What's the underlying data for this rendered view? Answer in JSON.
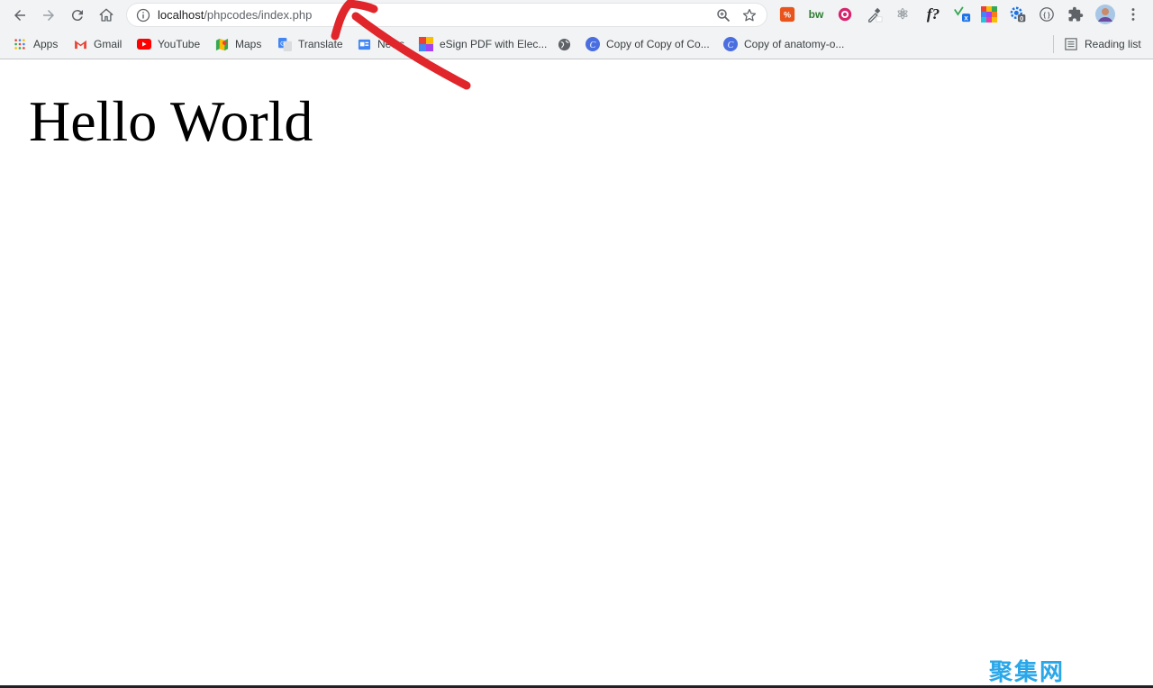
{
  "address_bar": {
    "url_host": "localhost",
    "url_path": "/phpcodes/index.php"
  },
  "extensions": [
    {
      "name": "extension-orange-icon",
      "glyph": "⁷⁄₂",
      "color": "#e8541c"
    },
    {
      "name": "extension-bw-icon",
      "glyph": "bw",
      "color": "#2e7d32"
    },
    {
      "name": "extension-eye-icon",
      "glyph": "◉",
      "color": "#d6246e"
    },
    {
      "name": "eyedropper-icon",
      "glyph": "",
      "color": "#5f6368"
    },
    {
      "name": "extension-react-icon",
      "glyph": "⚛",
      "color": "#9aa0a6"
    },
    {
      "name": "extension-fx-icon",
      "glyph": "f?",
      "color": "#202124"
    },
    {
      "name": "extension-translate-icon",
      "glyph": "x",
      "color": "#1a73e8"
    },
    {
      "name": "extension-grid-icon",
      "glyph": "",
      "color": "#fbbc04"
    },
    {
      "name": "extension-gear-badge-icon",
      "glyph": "0",
      "color": "#1a73e8"
    },
    {
      "name": "extension-braces-icon",
      "glyph": "{ }",
      "color": "#5f6368"
    }
  ],
  "bookmarks": [
    {
      "label": "Apps"
    },
    {
      "label": "Gmail"
    },
    {
      "label": "YouTube"
    },
    {
      "label": "Maps"
    },
    {
      "label": "Translate"
    },
    {
      "label": "News"
    },
    {
      "label": "eSign PDF with Elec..."
    },
    {
      "label": "Copy of Copy of Co..."
    },
    {
      "label": "Copy of anatomy-o..."
    }
  ],
  "reading_list": {
    "label": "Reading list"
  },
  "page": {
    "heading": "Hello World"
  },
  "watermark": {
    "text": "聚集网",
    "color": "#2aa7e8"
  },
  "annotation": {
    "color": "#e0252b"
  }
}
